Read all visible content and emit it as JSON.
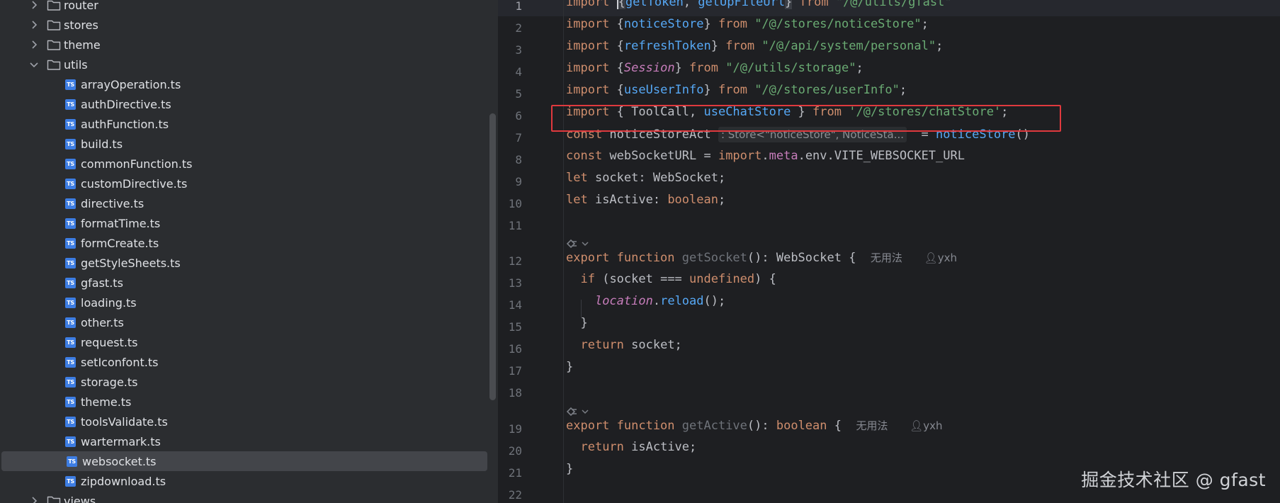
{
  "tree": {
    "items": [
      {
        "type": "folder",
        "label": "router",
        "expanded": false
      },
      {
        "type": "folder",
        "label": "stores",
        "expanded": false
      },
      {
        "type": "folder",
        "label": "theme",
        "expanded": false
      },
      {
        "type": "folder",
        "label": "utils",
        "expanded": true
      },
      {
        "type": "file",
        "label": "arrayOperation.ts"
      },
      {
        "type": "file",
        "label": "authDirective.ts"
      },
      {
        "type": "file",
        "label": "authFunction.ts"
      },
      {
        "type": "file",
        "label": "build.ts"
      },
      {
        "type": "file",
        "label": "commonFunction.ts"
      },
      {
        "type": "file",
        "label": "customDirective.ts"
      },
      {
        "type": "file",
        "label": "directive.ts"
      },
      {
        "type": "file",
        "label": "formatTime.ts"
      },
      {
        "type": "file",
        "label": "formCreate.ts"
      },
      {
        "type": "file",
        "label": "getStyleSheets.ts"
      },
      {
        "type": "file",
        "label": "gfast.ts"
      },
      {
        "type": "file",
        "label": "loading.ts"
      },
      {
        "type": "file",
        "label": "other.ts"
      },
      {
        "type": "file",
        "label": "request.ts"
      },
      {
        "type": "file",
        "label": "setIconfont.ts"
      },
      {
        "type": "file",
        "label": "storage.ts"
      },
      {
        "type": "file",
        "label": "theme.ts"
      },
      {
        "type": "file",
        "label": "toolsValidate.ts"
      },
      {
        "type": "file",
        "label": "wartermark.ts"
      },
      {
        "type": "file",
        "label": "websocket.ts",
        "selected": true
      },
      {
        "type": "file",
        "label": "zipdownload.ts"
      },
      {
        "type": "folder",
        "label": "views",
        "expanded": false
      }
    ],
    "file_badge": "TS"
  },
  "editor": {
    "line_numbers": [
      "1",
      "2",
      "3",
      "4",
      "5",
      "6",
      "7",
      "8",
      "9",
      "10",
      "11",
      "12",
      "13",
      "14",
      "15",
      "16",
      "17",
      "18",
      "19",
      "20",
      "21",
      "22"
    ],
    "inline_hint": ": Store<\"noticeStore\", NoticeSta...",
    "usage_label": "无用法",
    "author": "yxh"
  },
  "watermark": "掘金技术社区 @ gfast",
  "colors": {
    "keyword": "#cf8e6d",
    "identifier": "#56a8f5",
    "string": "#6aab73",
    "highlight_box": "#e0393e"
  }
}
